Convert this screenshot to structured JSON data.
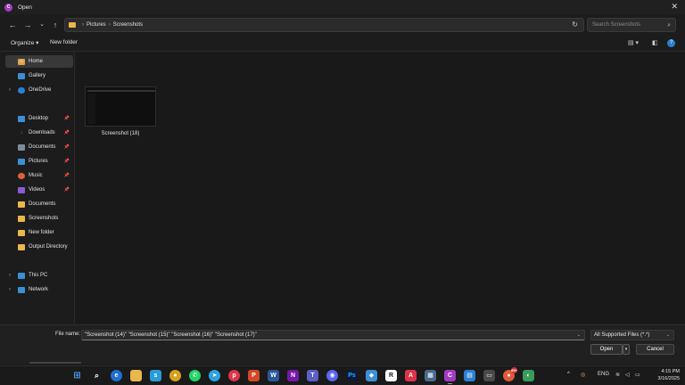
{
  "window": {
    "title": "Open"
  },
  "nav": {
    "breadcrumbs": [
      "Pictures",
      "Screenshots"
    ],
    "search_placeholder": "Search Screenshots"
  },
  "toolbar": {
    "organize_label": "Organize ▾",
    "new_folder_label": "New folder"
  },
  "sidebar": {
    "items": [
      {
        "label": "Home",
        "icon": "home-icon",
        "color": "#e2a04a"
      },
      {
        "label": "Gallery",
        "icon": "gallery-icon",
        "color": "#3a8fd6"
      },
      {
        "label": "OneDrive",
        "icon": "cloud-icon",
        "color": "#2a7fd4"
      },
      {
        "label": "Desktop",
        "icon": "desktop-icon",
        "color": "#3a8fd6"
      },
      {
        "label": "Downloads",
        "icon": "download-icon",
        "color": "#3ab37a"
      },
      {
        "label": "Documents",
        "icon": "document-icon",
        "color": "#7c8a9a"
      },
      {
        "label": "Pictures",
        "icon": "picture-icon",
        "color": "#3a8fd6"
      },
      {
        "label": "Music",
        "icon": "music-icon",
        "color": "#e0603a"
      },
      {
        "label": "Videos",
        "icon": "video-icon",
        "color": "#8a5ad6"
      },
      {
        "label": "Documents",
        "icon": "folder-icon",
        "color": "#e8b84a"
      },
      {
        "label": "Screenshots",
        "icon": "folder-icon",
        "color": "#e8b84a"
      },
      {
        "label": "New folder",
        "icon": "folder-icon",
        "color": "#e8b84a"
      },
      {
        "label": "Output Directory",
        "icon": "folder-icon",
        "color": "#e8b84a"
      },
      {
        "label": "This PC",
        "icon": "pc-icon",
        "color": "#3a8fd6"
      },
      {
        "label": "Network",
        "icon": "network-icon",
        "color": "#3a8fd6"
      }
    ]
  },
  "files": [
    {
      "name": "Screenshot (18)"
    }
  ],
  "footer": {
    "file_name_label": "File name:",
    "file_name_value": "\"Screenshot (14)\" \"Screenshot (15)\" \"Screenshot (16)\" \"Screenshot (17)\"",
    "file_type": "All Supported Files (*.*)",
    "open_label": "Open",
    "cancel_label": "Cancel"
  },
  "taskbar": {
    "language": "ENG",
    "time": "4:15 PM",
    "date": "3/16/2025",
    "notification_count": "99+"
  }
}
